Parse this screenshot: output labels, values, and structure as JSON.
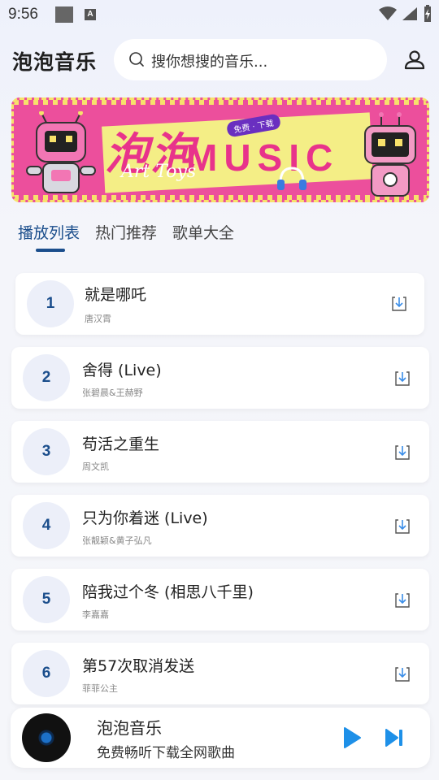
{
  "status_bar": {
    "time": "9:56",
    "icons": [
      "wifi-icon",
      "signal-icon",
      "battery-charging-icon"
    ]
  },
  "header": {
    "title": "泡泡音乐",
    "search_placeholder": "搜你想搜的音乐...",
    "search_icon": "search-icon",
    "user_icon": "user-icon"
  },
  "banner": {
    "title": "泡泡",
    "music": "MUSIC",
    "badge": "免费 · 下载",
    "art_text": "Art Toys"
  },
  "tabs": [
    {
      "label": "播放列表",
      "active": true
    },
    {
      "label": "热门推荐",
      "active": false
    },
    {
      "label": "歌单大全",
      "active": false
    }
  ],
  "songs": [
    {
      "number": "1",
      "title": "就是哪吒",
      "artist": "唐汉霄"
    },
    {
      "number": "2",
      "title": "舍得 (Live)",
      "artist": "张碧晨&王赫野"
    },
    {
      "number": "3",
      "title": "苟活之重生",
      "artist": "周文凯"
    },
    {
      "number": "4",
      "title": "只为你着迷 (Live)",
      "artist": "张靓颖&黄子弘凡"
    },
    {
      "number": "5",
      "title": "陪我过个冬 (相思八千里)",
      "artist": "李嘉嘉"
    },
    {
      "number": "6",
      "title": "第57次取消发送",
      "artist": "菲菲公主"
    }
  ],
  "player": {
    "title": "泡泡音乐",
    "subtitle": "免费畅听下载全网歌曲",
    "play_icon": "play-icon",
    "next_icon": "skip-next-icon"
  },
  "colors": {
    "accent": "#1b4e8c",
    "play_blue": "#1e90e8",
    "banner_pink": "#ec4f9c",
    "banner_yellow": "#f7e26b"
  }
}
